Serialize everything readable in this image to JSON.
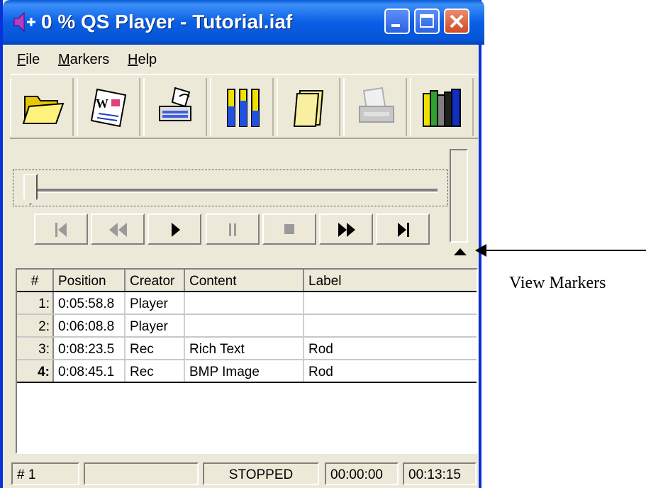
{
  "window": {
    "title": "0 % QS Player - Tutorial.iaf",
    "buttons": {
      "minimize": "minimize",
      "maximize": "maximize",
      "close": "close"
    }
  },
  "menu": {
    "file": {
      "accel": "F",
      "rest": "ile"
    },
    "markers": {
      "accel": "M",
      "rest": "arkers"
    },
    "help": {
      "accel": "H",
      "rest": "elp"
    }
  },
  "toolbar": {
    "icons": [
      "open-folder-icon",
      "word-document-icon",
      "typewriter-icon",
      "level-meters-icon",
      "folder-icon",
      "print-icon-disabled",
      "books-icon"
    ]
  },
  "markers_table": {
    "columns": [
      "#",
      "Position",
      "Creator",
      "Content",
      "Label"
    ],
    "rows": [
      {
        "num": "1:",
        "position": "0:05:58.8",
        "creator": "Player",
        "content": "",
        "label": ""
      },
      {
        "num": "2:",
        "position": "0:06:08.8",
        "creator": "Player",
        "content": "",
        "label": ""
      },
      {
        "num": "3:",
        "position": "0:08:23.5",
        "creator": "Rec",
        "content": "Rich Text",
        "label": "Rod"
      },
      {
        "num": "4:",
        "position": "0:08:45.1",
        "creator": "Rec",
        "content": "BMP Image",
        "label": "Rod"
      }
    ]
  },
  "status": {
    "marker": "# 1",
    "blank": "",
    "state": "STOPPED",
    "current_time": "00:00:00",
    "total_time": "00:13:15"
  },
  "annotation": {
    "text": "View Markers"
  },
  "colors": {
    "titlebar": "#0a5fe6",
    "face": "#ece9d8",
    "close_button": "#cf4a25"
  }
}
